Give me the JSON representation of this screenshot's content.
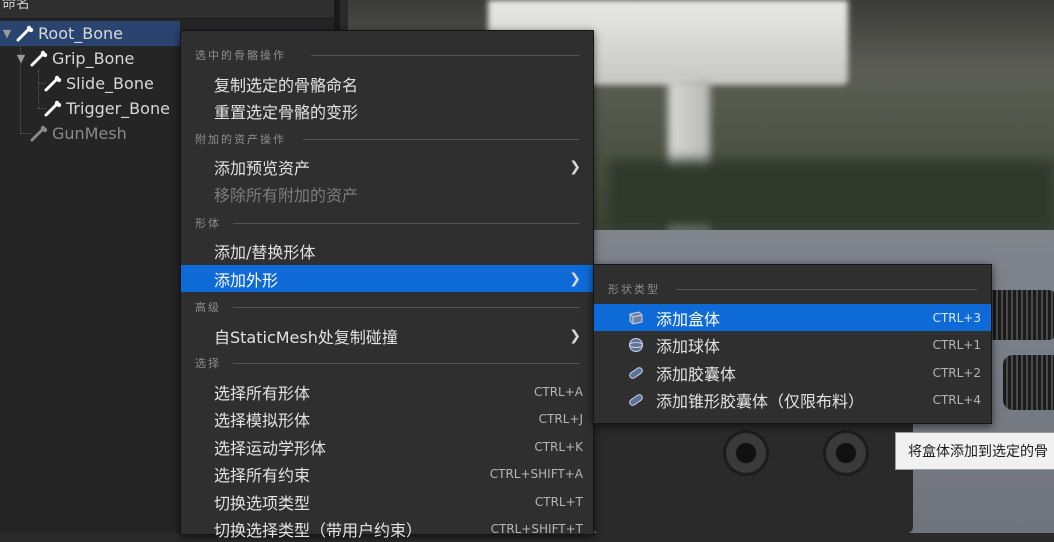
{
  "tree": {
    "header": "命名",
    "nodes": [
      {
        "label": "Root_Bone",
        "selected": true
      },
      {
        "label": "Grip_Bone"
      },
      {
        "label": "Slide_Bone"
      },
      {
        "label": "Trigger_Bone"
      },
      {
        "label": "GunMesh",
        "dim": true
      }
    ]
  },
  "context_menu": {
    "sections": [
      {
        "title": "选中的骨骼操作"
      },
      {
        "title": "附加的资产操作"
      },
      {
        "title": "形体"
      },
      {
        "title": "高级"
      },
      {
        "title": "选择"
      }
    ],
    "items": {
      "copy_bone_names": "复制选定的骨骼命名",
      "reset_bone_transforms": "重置选定骨骼的变形",
      "add_preview_asset": "添加预览资产",
      "remove_all_attached": "移除所有附加的资产",
      "add_replace_body": "添加/替换形体",
      "add_shape": "添加外形",
      "copy_collision_from_staticmesh": "自StaticMesh处复制碰撞",
      "select_all_bodies": "选择所有形体",
      "select_sim_bodies": "选择模拟形体",
      "select_kinematic_bodies": "选择运动学形体",
      "select_all_constraints": "选择所有约束",
      "toggle_select_type": "切换选项类型",
      "toggle_select_type_user": "切换选择类型（带用户约束）"
    },
    "shortcuts": {
      "select_all_bodies": "CTRL+A",
      "select_sim_bodies": "CTRL+J",
      "select_kinematic_bodies": "CTRL+K",
      "select_all_constraints": "CTRL+SHIFT+A",
      "toggle_select_type": "CTRL+T",
      "toggle_select_type_user": "CTRL+SHIFT+T"
    }
  },
  "submenu": {
    "title": "形状类型",
    "items": [
      {
        "label": "添加盒体",
        "shortcut": "CTRL+3",
        "icon": "box-icon",
        "highlighted": true
      },
      {
        "label": "添加球体",
        "shortcut": "CTRL+1",
        "icon": "sphere-icon"
      },
      {
        "label": "添加胶囊体",
        "shortcut": "CTRL+2",
        "icon": "capsule-icon"
      },
      {
        "label": "添加锥形胶囊体（仅限布料）",
        "shortcut": "CTRL+4",
        "icon": "tapered-capsule-icon"
      }
    ]
  },
  "tooltip": {
    "text": "将盒体添加到选定的骨"
  },
  "colors": {
    "highlight": "#0d6ad6",
    "menu_bg": "#2f2f2f",
    "tree_selected": "#2a4470"
  }
}
